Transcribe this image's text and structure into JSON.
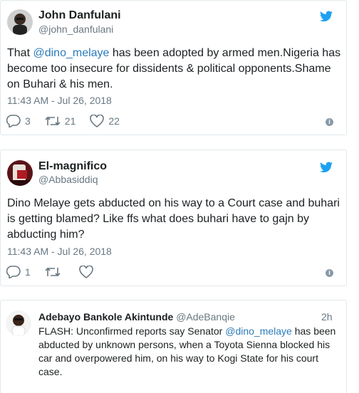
{
  "tweet1": {
    "name": "John Danfulani",
    "handle": "@john_danfulani",
    "text_pre": "That ",
    "mention": "@dino_melaye",
    "text_post": " has been adopted by armed men.Nigeria has become too insecure for dissidents & political opponents.Shame on Buhari & his men.",
    "time": "11:43 AM - Jul 26, 2018",
    "replies": "3",
    "retweets": "21",
    "likes": "22"
  },
  "tweet2": {
    "name": "El-magnifico",
    "handle": "@Abbasiddiq",
    "text": "Dino Melaye gets abducted on his way to a Court case and buhari is getting blamed? Like ffs what does buhari have to gajn by abducting him?",
    "time": "11:43 AM - Jul 26, 2018",
    "replies": "1"
  },
  "tweet3": {
    "name": "Adebayo Bankole Akintunde",
    "handle": "@AdeBanqie",
    "time": "2h",
    "text_pre": "FLASH: Unconfirmed reports say Senator ",
    "mention": "@dino_melaye",
    "text_post": " has been abducted by unknown persons, when a Toyota Sienna blocked his car and overpowered him, on his way to Kogi State for his court case."
  },
  "colors": {
    "link": "#2b7bb9",
    "bird": "#1da1f2",
    "muted": "#697882"
  }
}
